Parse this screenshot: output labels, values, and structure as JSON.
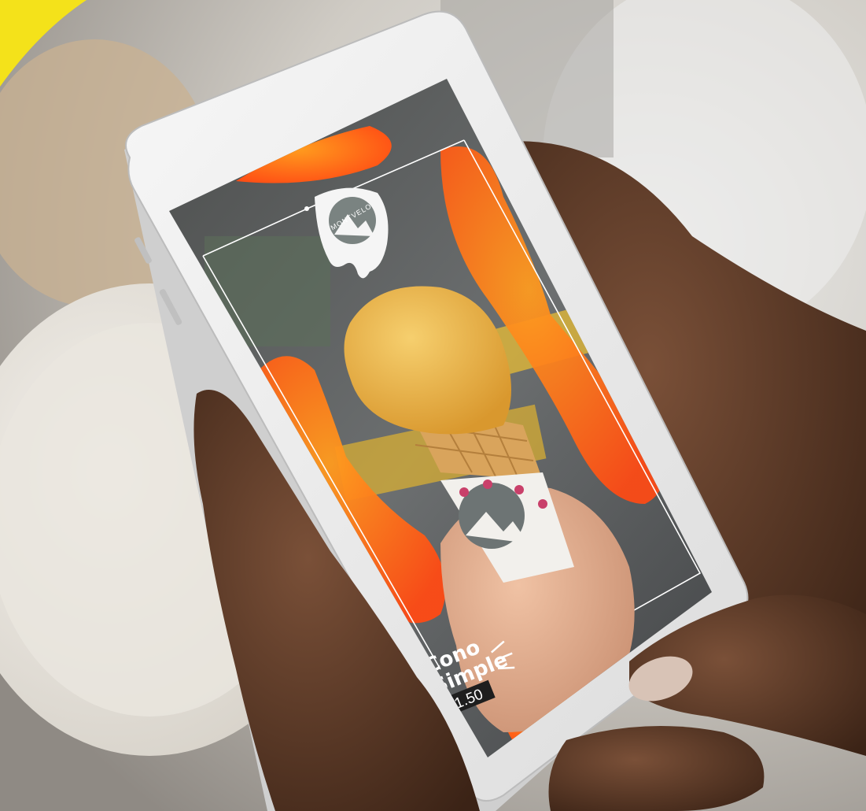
{
  "screen": {
    "brand_name": "MONTVELO",
    "product_line1": "Cono",
    "product_line2": "Simple",
    "price": "$1.50"
  },
  "colors": {
    "accent_yellow": "#f4e21a",
    "orange": "#ff6a1a",
    "orange_deep": "#ff4e12",
    "skin": "#5a3826",
    "ice_cream": "#f0b84a",
    "cone": "#d9a45c"
  }
}
